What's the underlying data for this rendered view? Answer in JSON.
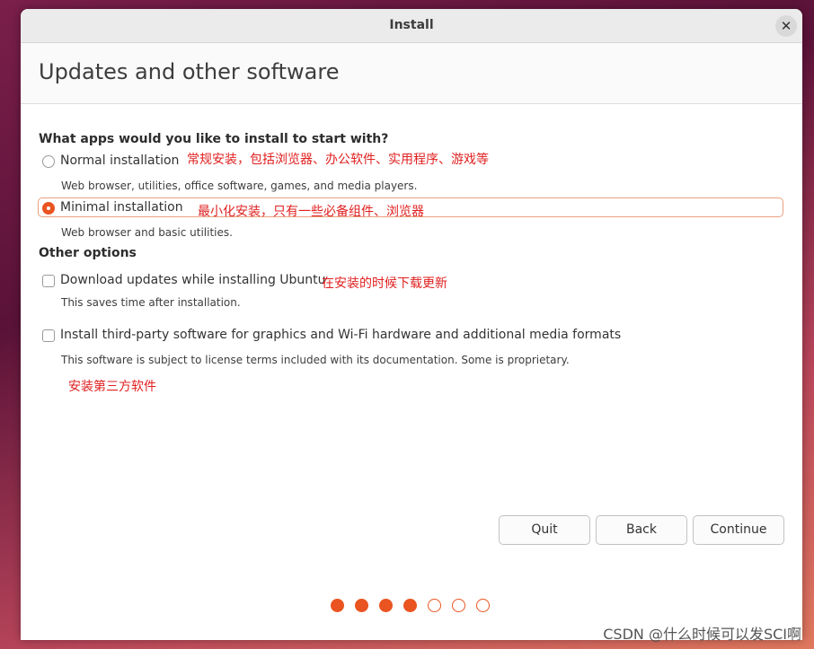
{
  "window": {
    "title": "Install",
    "close_glyph": "✕"
  },
  "page": {
    "title": "Updates and other software"
  },
  "apps": {
    "heading": "What apps would you like to install to start with?",
    "options": [
      {
        "label": "Normal installation",
        "description": "Web browser, utilities, office software, games, and media players.",
        "annotation": "常规安装，包括浏览器、办公软件、实用程序、游戏等",
        "selected": false
      },
      {
        "label": "Minimal installation",
        "description": "Web browser and basic utilities.",
        "annotation": "最小化安装，只有一些必备组件、浏览器",
        "selected": true
      }
    ]
  },
  "other": {
    "heading": "Other options",
    "options": [
      {
        "label": "Download updates while installing Ubuntu",
        "description": "This saves time after installation.",
        "annotation": "在安装的时候下载更新",
        "checked": false
      },
      {
        "label": "Install third-party software for graphics and Wi-Fi hardware and additional media formats",
        "description": "This software is subject to license terms included with its documentation. Some is proprietary.",
        "annotation": "安装第三方软件",
        "checked": false
      }
    ]
  },
  "buttons": {
    "quit": "Quit",
    "back": "Back",
    "continue": "Continue"
  },
  "progress": {
    "total_steps": 7,
    "completed_steps": 4
  },
  "watermark": "CSDN @什么时候可以发SCI啊",
  "colors": {
    "accent": "#e95420",
    "annotation": "#e02020"
  },
  "icons": {
    "close": "close-icon"
  }
}
